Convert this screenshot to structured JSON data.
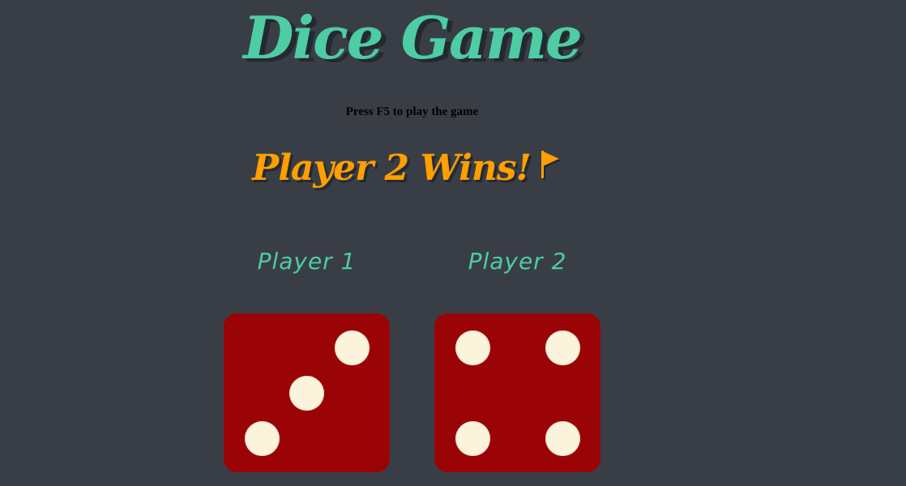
{
  "game": {
    "title": "Dice Game",
    "instruction": "Press F5 to play the game",
    "result_text": "Player 2 Wins!",
    "result_icon": "flag-icon"
  },
  "players": [
    {
      "label": "Player 1",
      "die_value": 3
    },
    {
      "label": "Player 2",
      "die_value": 4
    }
  ],
  "colors": {
    "background": "#393e46",
    "title": "#4ecca3",
    "winner": "#ff9f00",
    "die": "#9a0407",
    "pip": "#fbf3dc"
  }
}
